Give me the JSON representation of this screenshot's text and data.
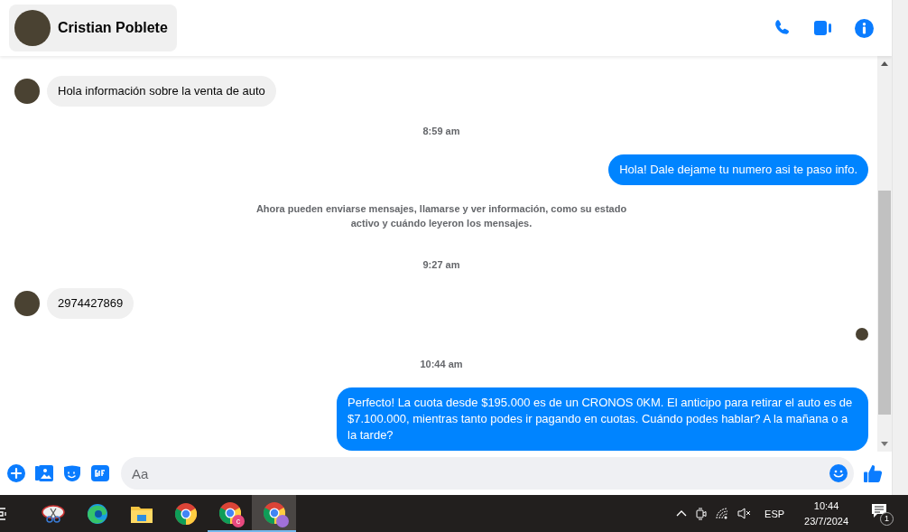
{
  "header": {
    "contact_name": "Cristian Poblete"
  },
  "messages": [
    {
      "kind": "incoming",
      "text": "Hola información sobre la venta de auto",
      "avatar": true
    },
    {
      "kind": "timestamp",
      "text": "8:59 am"
    },
    {
      "kind": "outgoing",
      "text": "Hola! Dale dejame tu numero  asi te paso info."
    },
    {
      "kind": "notice",
      "text": "Ahora pueden enviarse mensajes, llamarse y ver información, como su estado activo y cuándo leyeron los mensajes."
    },
    {
      "kind": "timestamp",
      "text": "9:27 am"
    },
    {
      "kind": "incoming",
      "text": "2974427869",
      "avatar": true
    },
    {
      "kind": "read-receipt"
    },
    {
      "kind": "timestamp",
      "text": "10:44 am"
    },
    {
      "kind": "outgoing",
      "text": "Perfecto! La cuota desde $195.000 es de un CRONOS 0KM. El anticipo para retirar el auto es de $7.100.000, mientras tanto podes ir pagando en cuotas. Cuándo podes hablar? A la mañana o a la tarde?"
    }
  ],
  "composer": {
    "placeholder": "Aa"
  },
  "taskbar": {
    "apps": [
      {
        "kind": "snip",
        "selected": false,
        "running": false
      },
      {
        "kind": "edge",
        "selected": false,
        "running": false
      },
      {
        "kind": "folder",
        "selected": false,
        "running": false
      },
      {
        "kind": "chrome",
        "selected": false,
        "running": false
      },
      {
        "kind": "chrome-c",
        "selected": false,
        "running": true,
        "badge": "c"
      },
      {
        "kind": "chrome-profile",
        "selected": true,
        "running": true
      }
    ],
    "language": "ESP",
    "time": "10:44",
    "date": "23/7/2024",
    "notification_count": "1"
  }
}
